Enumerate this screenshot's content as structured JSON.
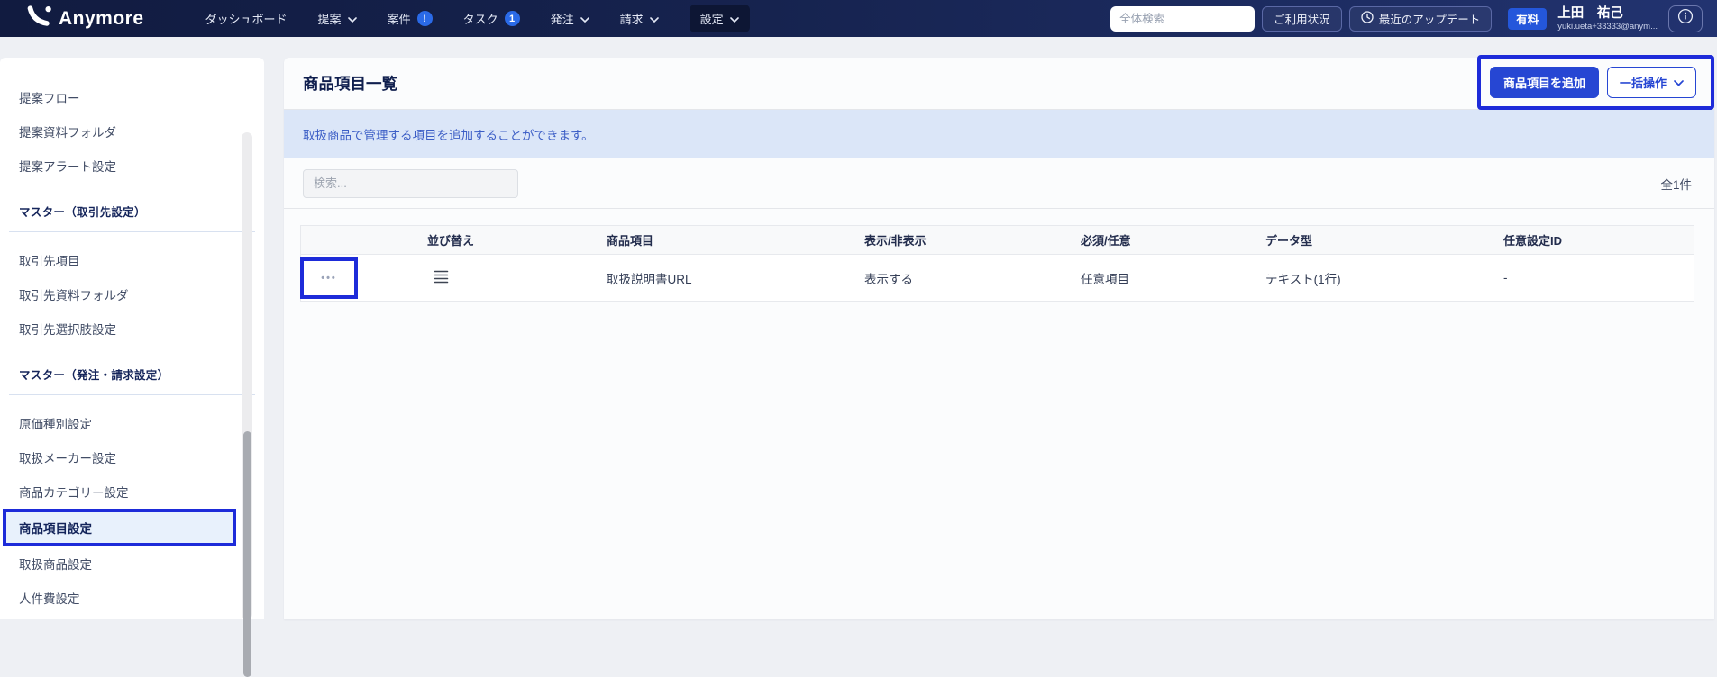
{
  "nav": {
    "brand": "Anymore",
    "items": [
      {
        "label": "ダッシュボード",
        "chevron": false,
        "badge": null
      },
      {
        "label": "提案",
        "chevron": true,
        "badge": null
      },
      {
        "label": "案件",
        "chevron": false,
        "badge": "!"
      },
      {
        "label": "タスク",
        "chevron": false,
        "badge": "1"
      },
      {
        "label": "発注",
        "chevron": true,
        "badge": null
      },
      {
        "label": "請求",
        "chevron": true,
        "badge": null
      },
      {
        "label": "設定",
        "chevron": true,
        "badge": null,
        "active": true
      }
    ],
    "search_placeholder": "全体検索",
    "usage_button": "ご利用状況",
    "updates_button": "最近のアップデート",
    "plan_badge": "有料",
    "user_name": "上田　祐己",
    "user_email": "yuki.ueta+33333@anym..."
  },
  "sidebar": {
    "groups": [
      {
        "header": null,
        "items": [
          "提案フロー",
          "提案資料フォルダ",
          "提案アラート設定"
        ]
      },
      {
        "header": "マスター（取引先設定）",
        "items": [
          "取引先項目",
          "取引先資料フォルダ",
          "取引先選択肢設定"
        ]
      },
      {
        "header": "マスター（発注・請求設定）",
        "items": [
          "原価種別設定",
          "取扱メーカー設定",
          "商品カテゴリー設定",
          "商品項目設定",
          "取扱商品設定",
          "人件費設定"
        ],
        "active_item": "商品項目設定"
      }
    ]
  },
  "main": {
    "title": "商品項目一覧",
    "add_button": "商品項目を追加",
    "bulk_button": "一括操作",
    "banner": "取扱商品で管理する項目を追加することができます。",
    "search_placeholder": "検索...",
    "count": "全1件",
    "table": {
      "headers": [
        "並び替え",
        "商品項目",
        "表示/非表示",
        "必須/任意",
        "データ型",
        "任意設定ID"
      ],
      "rows": [
        {
          "item": "取扱説明書URL",
          "display": "表示する",
          "required": "任意項目",
          "data_type": "テキスト(1行)",
          "custom_id": "-"
        }
      ]
    }
  },
  "colors": {
    "annotation_blue": "#1d2bd9",
    "accent_blue": "#2646d3",
    "banner_bg": "#dbe6f8",
    "nav_gradient_left": "#111b40",
    "nav_gradient_right": "#223370",
    "badge_blue": "#2a6ae8",
    "plan_badge_blue": "#2457db"
  }
}
